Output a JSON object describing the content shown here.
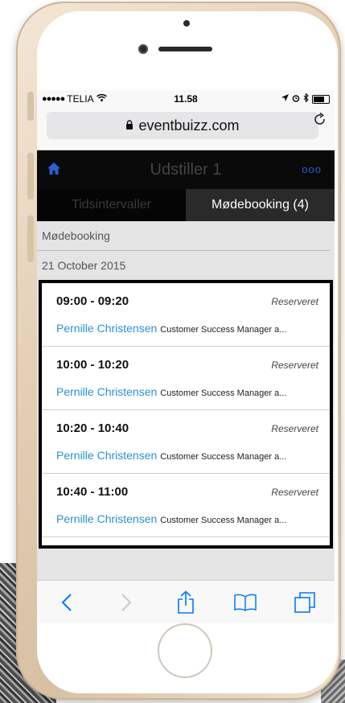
{
  "status_bar": {
    "carrier": "TELIA",
    "time": "11.58"
  },
  "browser": {
    "url": "eventbuizz.com"
  },
  "app": {
    "title": "Udstiller 1",
    "menu_dots": "ooo"
  },
  "tabs": [
    {
      "label": "Tidsintervaller",
      "active": false
    },
    {
      "label": "Mødebooking (4)",
      "active": true
    }
  ],
  "section": {
    "title": "Mødebooking",
    "date": "21 October 2015"
  },
  "bookings": [
    {
      "time": "09:00 - 09:20",
      "status": "Reserveret",
      "name": "Pernille Christensen",
      "role": "Customer Success Manager a..."
    },
    {
      "time": "10:00 - 10:20",
      "status": "Reserveret",
      "name": "Pernille Christensen",
      "role": "Customer Success Manager a..."
    },
    {
      "time": "10:20 - 10:40",
      "status": "Reserveret",
      "name": "Pernille Christensen",
      "role": "Customer Success Manager a..."
    },
    {
      "time": "10:40 - 11:00",
      "status": "Reserveret",
      "name": "Pernille Christensen",
      "role": "Customer Success Manager a..."
    }
  ],
  "colors": {
    "accent": "#2b8fd6",
    "header_bg": "#0a0a0a",
    "ios_blue": "#007aff"
  },
  "icons": {
    "home": "home-icon",
    "lock": "lock-icon",
    "reload": "reload-icon",
    "back": "chevron-left-icon",
    "forward": "chevron-right-icon",
    "share": "share-icon",
    "bookmarks": "book-icon",
    "tabs": "tabs-icon"
  }
}
